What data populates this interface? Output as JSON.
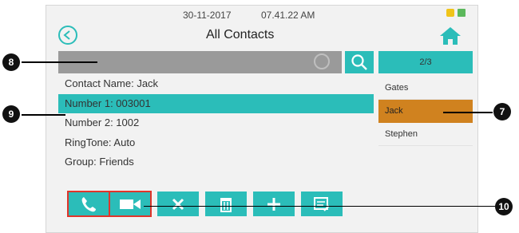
{
  "status": {
    "date": "30-11-2017",
    "time": "07.41.22 AM",
    "icons": [
      "lock-icon",
      "network-icon"
    ]
  },
  "header": {
    "title": "All Contacts",
    "back_icon": "back-arrow-icon",
    "home_icon": "home-icon"
  },
  "search": {
    "value": "",
    "clear_icon": "clear-icon",
    "button_icon": "search-icon"
  },
  "contacts_panel": {
    "page": "2/3",
    "items": [
      "Gates",
      "Jack",
      "Stephen"
    ],
    "selected": "Jack"
  },
  "details": {
    "rows": [
      "Contact Name: Jack",
      "Number 1: 003001",
      "Number 2: 1002",
      "RingTone: Auto",
      "Group: Friends"
    ],
    "selected_index": 1
  },
  "toolbar": {
    "buttons": [
      "phone-icon",
      "video-icon",
      "delete-x-icon",
      "trash-icon",
      "add-icon",
      "edit-icon"
    ]
  },
  "callouts": {
    "left_top": "8",
    "left_mid": "9",
    "right_mid": "7",
    "right_bottom": "10"
  },
  "colors": {
    "accent": "#2bbdb9",
    "selected": "#d0821f",
    "highlight_box": "#e0352b"
  }
}
